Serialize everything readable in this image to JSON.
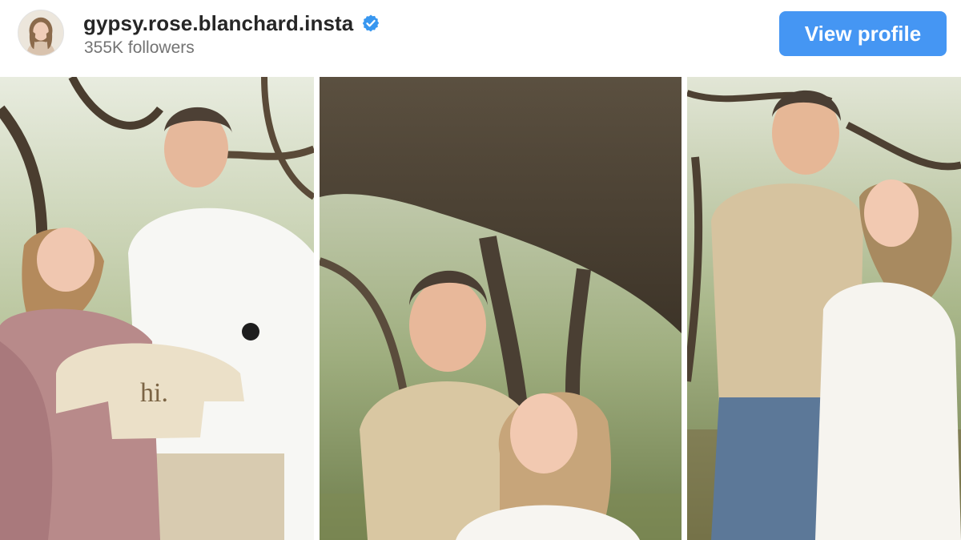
{
  "profile": {
    "username": "gypsy.rose.blanchard.insta",
    "followers": "355K followers",
    "verified": true,
    "avatar_icon": "profile-avatar"
  },
  "actions": {
    "view_profile_label": "View profile"
  },
  "posts": [
    {
      "sweater_text": "hi."
    },
    {},
    {}
  ],
  "colors": {
    "button": "#4596f3",
    "verified_badge": "#3897f0",
    "username": "#262626",
    "muted_text": "#737373"
  }
}
